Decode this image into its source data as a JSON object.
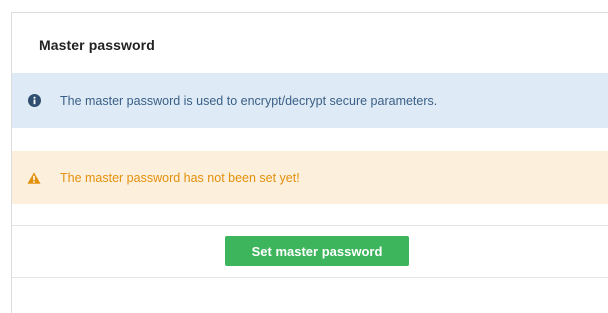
{
  "panel": {
    "title": "Master password"
  },
  "alerts": {
    "info": {
      "icon": "info-circle-icon",
      "message": "The master password is used to encrypt/decrypt secure parameters.",
      "color": "#3a5f86",
      "background": "#deebf6"
    },
    "warning": {
      "icon": "warning-triangle-icon",
      "message": "The master password has not been set yet!",
      "color": "#e3910d",
      "background": "#fcefdc"
    }
  },
  "actions": {
    "set_password_label": "Set master password",
    "button_color": "#3cb55c"
  }
}
